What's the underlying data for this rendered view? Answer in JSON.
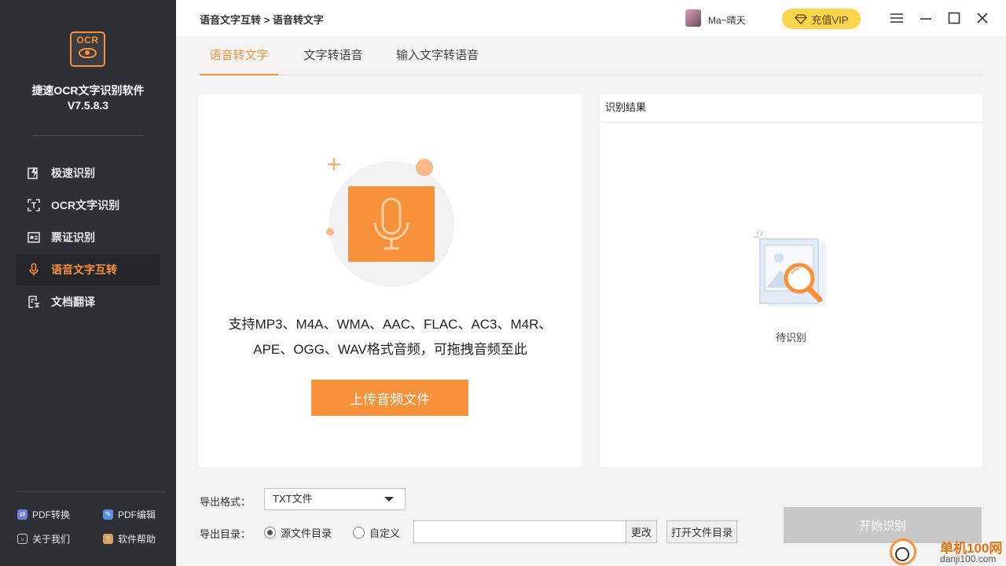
{
  "app": {
    "logo_text": "OCR",
    "name": "捷速OCR文字识别软件",
    "version": "V7.5.8.3"
  },
  "sidebar": {
    "items": [
      {
        "label": "极速识别",
        "icon": "fast-scan-icon",
        "active": false
      },
      {
        "label": "OCR文字识别",
        "icon": "ocr-frame-icon",
        "active": false
      },
      {
        "label": "票证识别",
        "icon": "ticket-icon",
        "active": false
      },
      {
        "label": "语音文字互转",
        "icon": "microphone-icon",
        "active": true
      },
      {
        "label": "文档翻译",
        "icon": "translate-doc-icon",
        "active": false
      }
    ],
    "tools": {
      "pdf_convert": "PDF转换",
      "pdf_edit": "PDF编辑",
      "about": "关于我们",
      "help": "软件帮助"
    }
  },
  "header": {
    "breadcrumb": "语音文字互转 > 语音转文字",
    "username": "Ma~晴天",
    "vip_label": "充值VIP"
  },
  "tabs": [
    {
      "label": "语音转文字",
      "active": true
    },
    {
      "label": "文字转语音",
      "active": false
    },
    {
      "label": "输入文字转语音",
      "active": false
    }
  ],
  "upload": {
    "hint_line1": "支持MP3、M4A、WMA、AAC、FLAC、AC3、M4R、",
    "hint_line2": "APE、OGG、WAV格式音频，可拖拽音频至此",
    "button": "上传音频文件"
  },
  "result": {
    "title": "识别结果",
    "status": "待识别"
  },
  "export": {
    "format_label": "导出格式：",
    "format_value": "TXT文件",
    "dir_label": "导出目录：",
    "option_source": "源文件目录",
    "option_custom": "自定义",
    "path_value": "",
    "change_button": "更改",
    "open_dir_button": "打开文件目录",
    "start_button": "开始识别"
  },
  "watermark": {
    "line1": "单机100网",
    "line2": "danji100.com"
  },
  "colors": {
    "accent": "#f7923a",
    "sidebar_bg": "#2e3036",
    "vip_bg": "#fcd54a"
  }
}
